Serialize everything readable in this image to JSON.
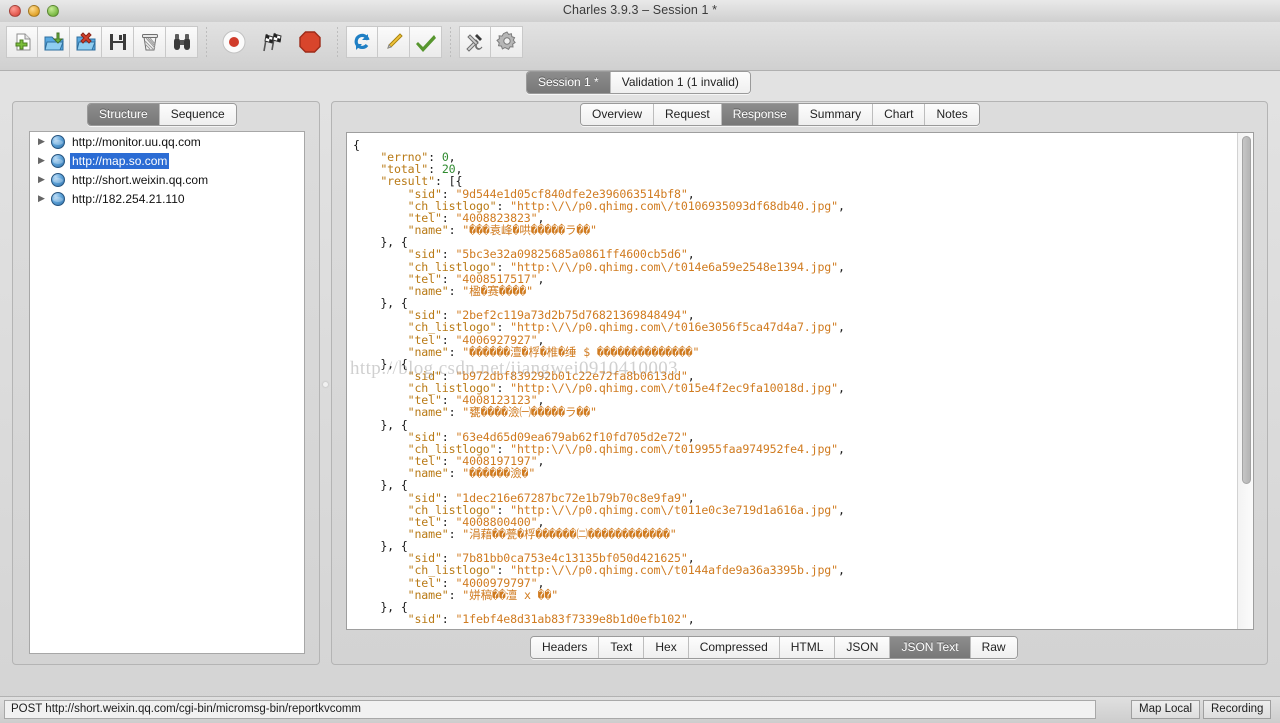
{
  "window": {
    "title": "Charles 3.9.3 – Session 1 *",
    "traffic_lights": [
      "close-button",
      "minimize-button",
      "zoom-button"
    ]
  },
  "toolbar": {
    "groups": [
      {
        "name": "file-group",
        "buttons": [
          {
            "name": "new-session-button",
            "icon": "new-document-icon",
            "tooltip": "New Session"
          },
          {
            "name": "open-session-button",
            "icon": "open-folder-icon",
            "tooltip": "Open Session"
          },
          {
            "name": "close-session-button",
            "icon": "close-folder-icon",
            "tooltip": "Close Session"
          },
          {
            "name": "save-session-button",
            "icon": "floppy-disk-icon",
            "tooltip": "Save Session"
          },
          {
            "name": "clear-session-button",
            "icon": "trash-can-icon",
            "tooltip": "Clear Session"
          },
          {
            "name": "find-button",
            "icon": "binoculars-icon",
            "tooltip": "Find"
          }
        ]
      },
      {
        "name": "recording-group",
        "buttons": [
          {
            "name": "record-toggle-button",
            "icon": "record-dot-icon",
            "tooltip": "Start/Stop Recording"
          },
          {
            "name": "breakpoints-button",
            "icon": "checkered-flags-icon",
            "tooltip": "Breakpoints"
          },
          {
            "name": "throttle-button",
            "icon": "stop-octagon-icon",
            "tooltip": "Throttling"
          }
        ]
      },
      {
        "name": "tools-group",
        "buttons": [
          {
            "name": "repeat-button",
            "icon": "repeat-arrows-icon",
            "tooltip": "Repeat"
          },
          {
            "name": "compose-button",
            "icon": "pencil-icon",
            "tooltip": "Compose"
          },
          {
            "name": "validate-button",
            "icon": "green-check-icon",
            "tooltip": "Validate"
          }
        ]
      },
      {
        "name": "settings-group",
        "buttons": [
          {
            "name": "tools-button",
            "icon": "hammer-wrench-icon",
            "tooltip": "Tools"
          },
          {
            "name": "settings-button",
            "icon": "gear-icon",
            "tooltip": "Settings"
          }
        ]
      }
    ]
  },
  "session_tabs": {
    "items": [
      {
        "label": "Session 1 *",
        "active": true
      },
      {
        "label": "Validation 1 (1 invalid)",
        "active": false
      }
    ]
  },
  "left_pane": {
    "tabs": [
      {
        "label": "Structure",
        "active": true
      },
      {
        "label": "Sequence",
        "active": false
      }
    ],
    "tree": [
      {
        "label": "http://monitor.uu.qq.com",
        "icon": "globe-icon",
        "selected": false,
        "expanded": false
      },
      {
        "label": "http://map.so.com",
        "icon": "globe-icon",
        "selected": true,
        "expanded": false
      },
      {
        "label": "http://short.weixin.qq.com",
        "icon": "globe-icon",
        "selected": false,
        "expanded": false
      },
      {
        "label": "http://182.254.21.110",
        "icon": "globe-icon",
        "selected": false,
        "expanded": false
      }
    ]
  },
  "right_pane": {
    "tabs": [
      {
        "label": "Overview",
        "active": false
      },
      {
        "label": "Request",
        "active": false
      },
      {
        "label": "Response",
        "active": true
      },
      {
        "label": "Summary",
        "active": false
      },
      {
        "label": "Chart",
        "active": false
      },
      {
        "label": "Notes",
        "active": false
      }
    ],
    "view_tabs": [
      {
        "label": "Headers",
        "active": false
      },
      {
        "label": "Text",
        "active": false
      },
      {
        "label": "Hex",
        "active": false
      },
      {
        "label": "Compressed",
        "active": false
      },
      {
        "label": "HTML",
        "active": false
      },
      {
        "label": "JSON",
        "active": false
      },
      {
        "label": "JSON Text",
        "active": true
      },
      {
        "label": "Raw",
        "active": false
      }
    ],
    "watermark": "http://blog.csdn.net/jiangwei0910410003",
    "json_body": {
      "errno": 0,
      "total": 20,
      "results": [
        {
          "sid": "9d544e1d05cf840dfe2e396063514bf8",
          "ch_listlogo": "http:\\/\\/p0.qhimg.com\\/t0106935093df68db40.jpg",
          "tel": "4008823823",
          "name": "���袁峰�哄�����ラ��"
        },
        {
          "sid": "5bc3e32a09825685a0861ff4600cb5d6",
          "ch_listlogo": "http:\\/\\/p0.qhimg.com\\/t014e6a59e2548e1394.jpg",
          "tel": "4008517517",
          "name": "楹�赛����"
        },
        {
          "sid": "2bef2c119a73d2b75d76821369848494",
          "ch_listlogo": "http:\\/\\/p0.qhimg.com\\/t016e3056f5ca47d4a7.jpg",
          "tel": "4006927927",
          "name": "������澶�桴�椎�缍 $ ��������������"
        },
        {
          "sid": "b972dbf839292b01c22e72fa8b0613dd",
          "ch_listlogo": "http:\\/\\/p0.qhimg.com\\/t015e4f2ec9fa10018d.jpg",
          "tel": "4008123123",
          "name": "甕����澰㈠�����ラ��"
        },
        {
          "sid": "63e4d65d09ea679ab62f10fd705d2e72",
          "ch_listlogo": "http:\\/\\/p0.qhimg.com\\/t019955faa974952fe4.jpg",
          "tel": "4008197197",
          "name": "������澰�"
        },
        {
          "sid": "1dec216e67287bc72e1b79b70c8e9fa9",
          "ch_listlogo": "http:\\/\\/p0.qhimg.com\\/t011e0c3e719d1a616a.jpg",
          "tel": "4008800400",
          "name": "涓藉��甍�桴������㈡������������"
        },
        {
          "sid": "7b81bb0ca753e4c13135bf050d421625",
          "ch_listlogo": "http:\\/\\/p0.qhimg.com\\/t0144afde9a36a3395b.jpg",
          "tel": "4000979797",
          "name": "姘稿��澶 x ��"
        },
        {
          "sid": "1febf4e8d31ab83f7339e8b1d0efb102"
        }
      ]
    }
  },
  "statusbar": {
    "url": "POST http://short.weixin.qq.com/cgi-bin/micromsg-bin/reportkvcomm",
    "buttons": [
      {
        "label": "Map Local"
      },
      {
        "label": "Recording"
      }
    ]
  }
}
